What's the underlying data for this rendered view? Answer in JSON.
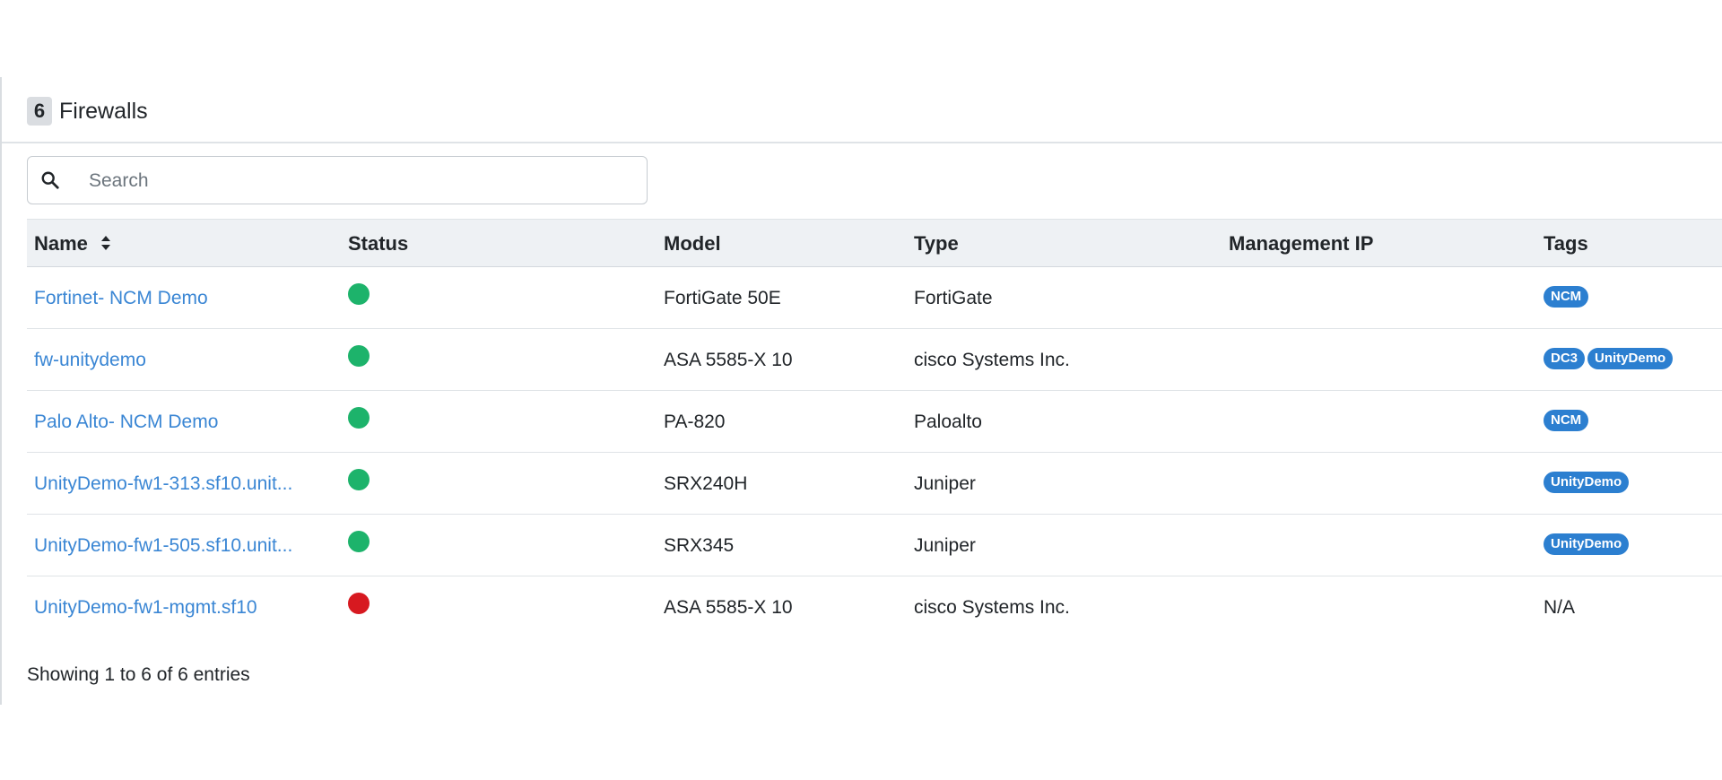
{
  "header": {
    "count": "6",
    "title": "Firewalls"
  },
  "search": {
    "placeholder": "Search",
    "value": ""
  },
  "table": {
    "columns": {
      "name": "Name",
      "status": "Status",
      "model": "Model",
      "type": "Type",
      "management_ip": "Management IP",
      "tags": "Tags"
    },
    "rows": [
      {
        "name": "Fortinet- NCM Demo",
        "status": "up",
        "model": "FortiGate 50E",
        "type": "FortiGate",
        "management_ip": "",
        "tags": [
          "NCM"
        ]
      },
      {
        "name": "fw-unitydemo",
        "status": "up",
        "model": "ASA 5585-X 10",
        "type": "cisco Systems Inc.",
        "management_ip": "",
        "tags": [
          "DC3",
          "UnityDemo"
        ]
      },
      {
        "name": "Palo Alto- NCM Demo",
        "status": "up",
        "model": "PA-820",
        "type": "Paloalto",
        "management_ip": "",
        "tags": [
          "NCM"
        ]
      },
      {
        "name": "UnityDemo-fw1-313.sf10.unit...",
        "status": "up",
        "model": "SRX240H",
        "type": "Juniper",
        "management_ip": "",
        "tags": [
          "UnityDemo"
        ]
      },
      {
        "name": "UnityDemo-fw1-505.sf10.unit...",
        "status": "up",
        "model": "SRX345",
        "type": "Juniper",
        "management_ip": "",
        "tags": [
          "UnityDemo"
        ]
      },
      {
        "name": "UnityDemo-fw1-mgmt.sf10",
        "status": "down",
        "model": "ASA 5585-X 10",
        "type": "cisco Systems Inc.",
        "management_ip": "",
        "tags": [],
        "tags_text": "N/A"
      }
    ]
  },
  "footer": {
    "info": "Showing 1 to 6 of 6 entries"
  },
  "colors": {
    "status_up": "#1db36b",
    "status_down": "#d71920",
    "tag_bg": "#2c7fd0",
    "link": "#3a86d4"
  }
}
